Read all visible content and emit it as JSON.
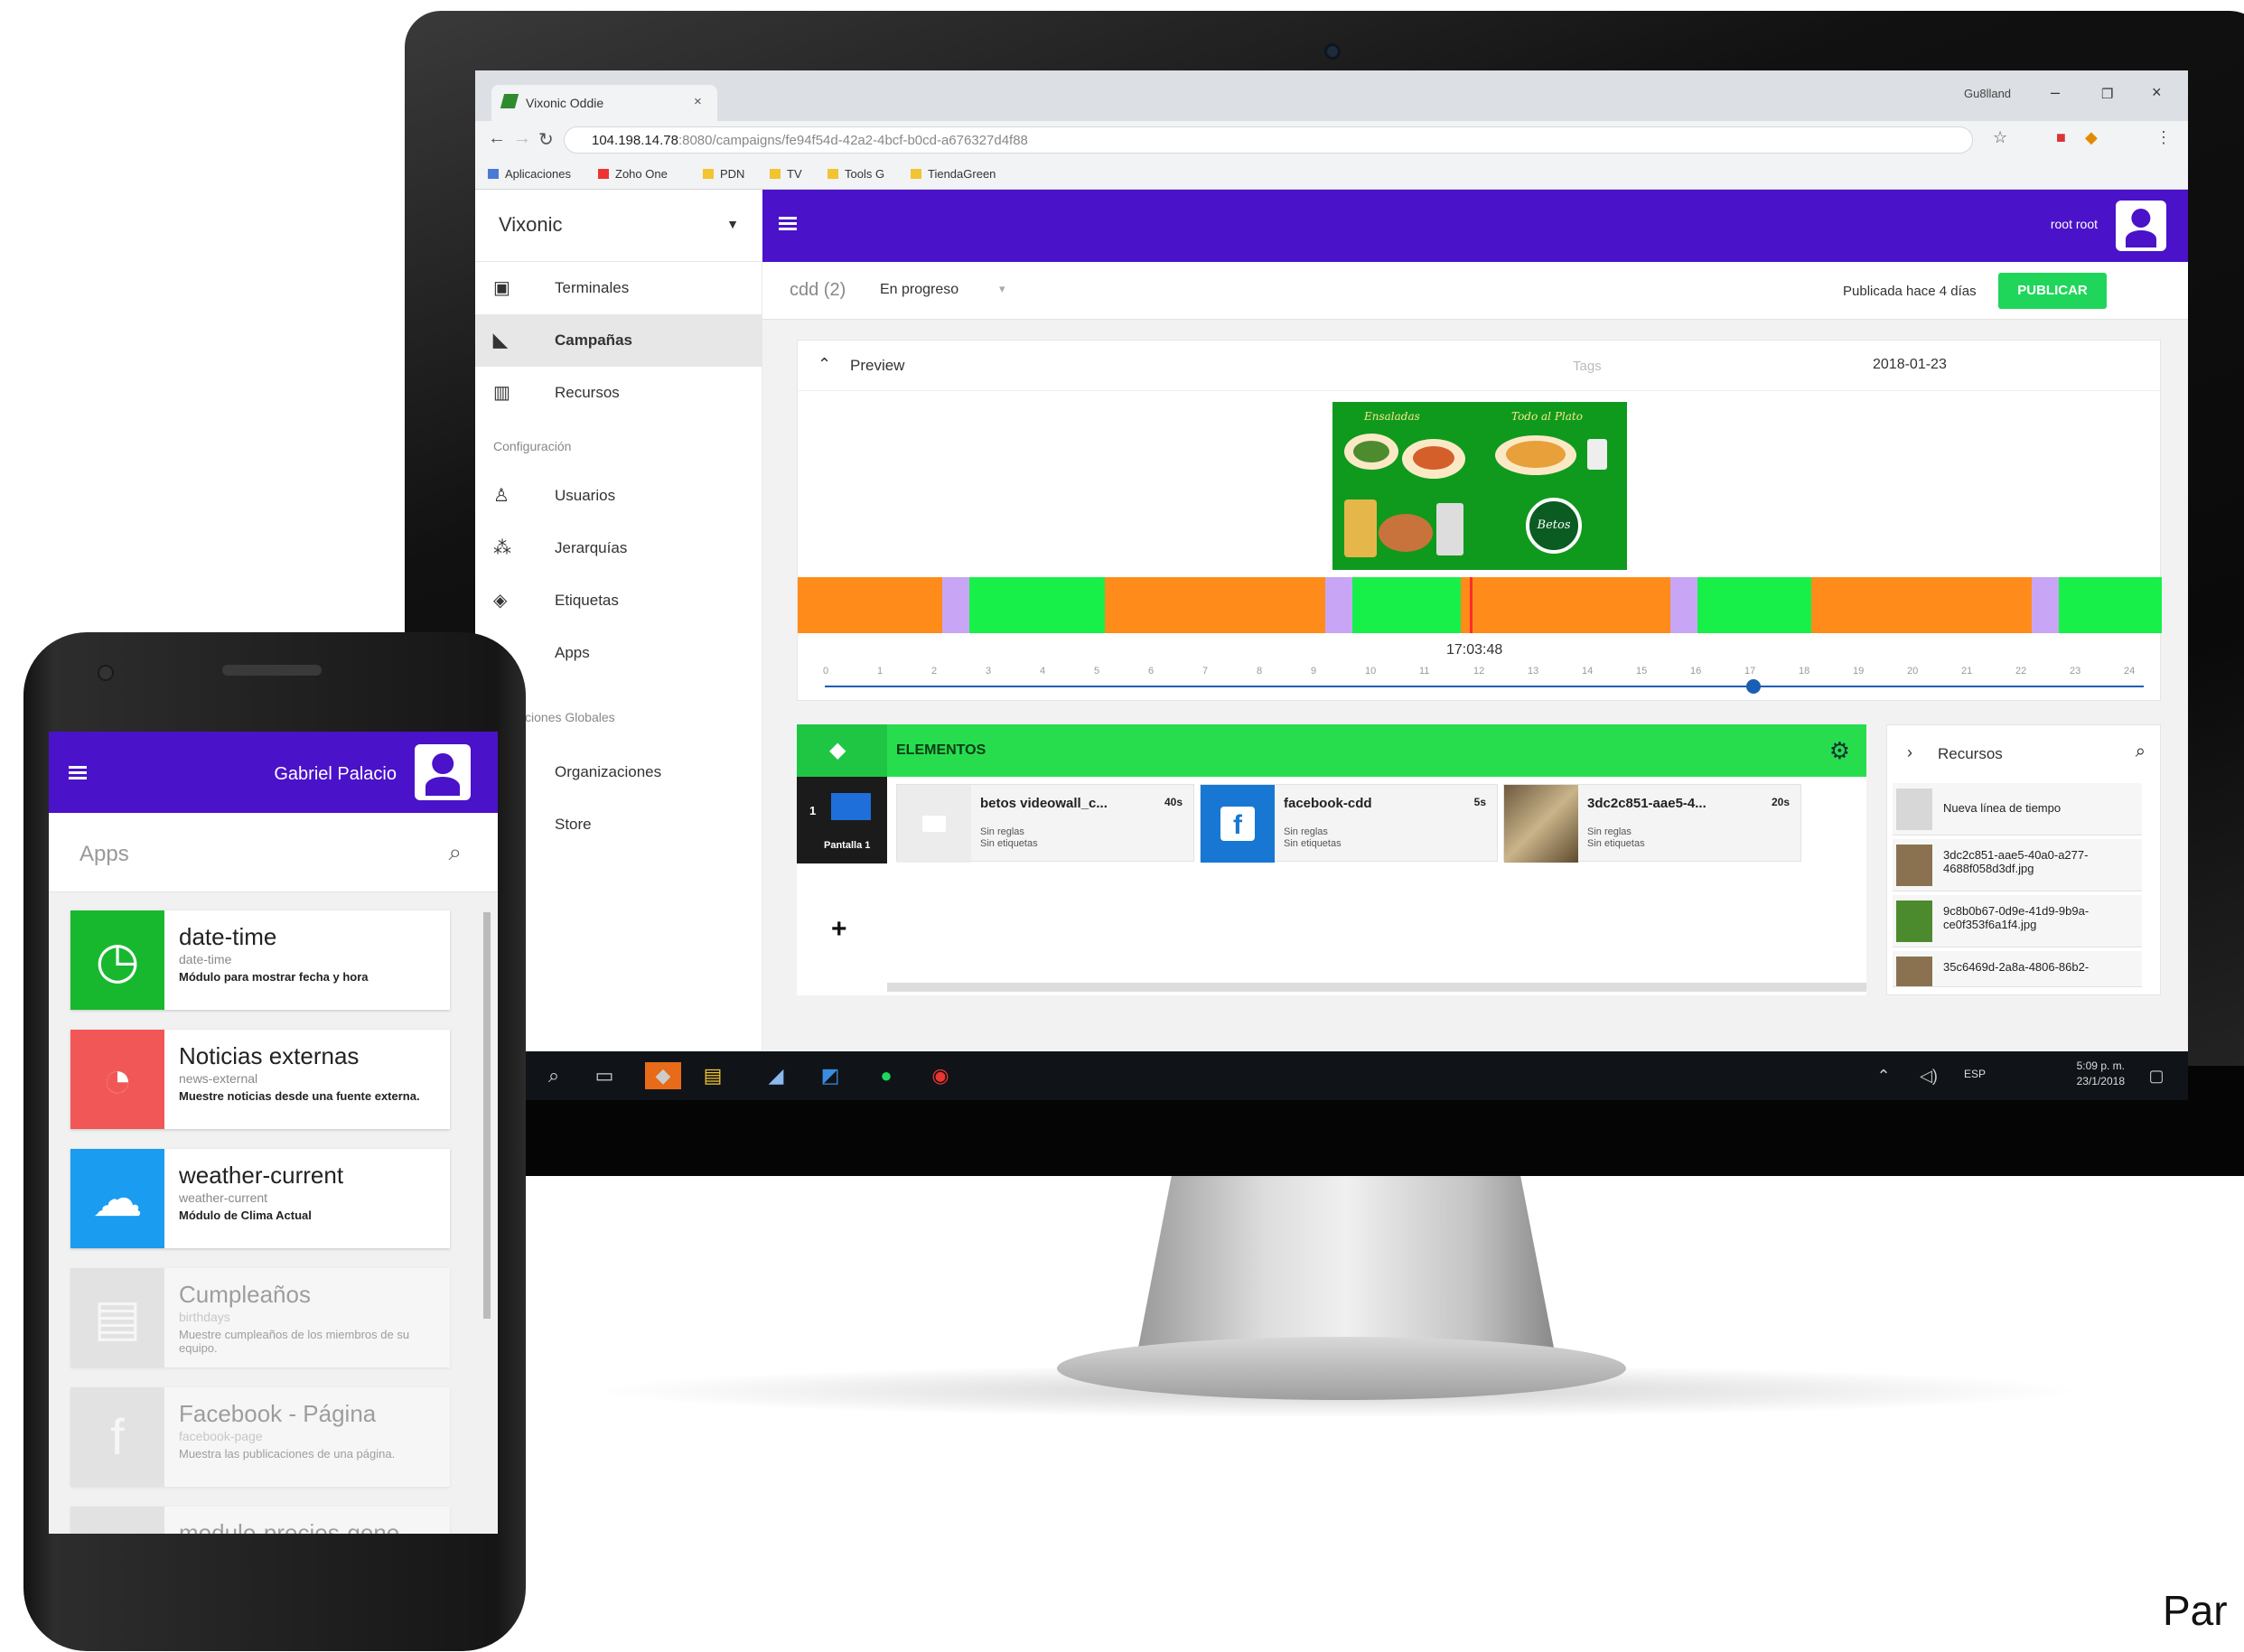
{
  "browser": {
    "tab_title": "Vixonic Oddie",
    "window_user": "Gu8lland",
    "url_host": "104.198.14.78",
    "url_rest": ":8080/campaigns/fe94f54d-42a2-4bcf-b0cd-a676327d4f88",
    "bookmarks": [
      "Aplicaciones",
      "Zoho One",
      "PDN",
      "TV",
      "Tools G",
      "TiendaGreen"
    ]
  },
  "app": {
    "brand": "Vixonic",
    "user": "root root",
    "colors": {
      "header": "#4a12c9",
      "accent_green": "#1fd65a",
      "timeline_orange": "#ff8c1a",
      "timeline_green": "#18f04a",
      "timeline_lilac": "#c8a6f5"
    },
    "sidebar": {
      "items": [
        {
          "label": "Terminales",
          "icon": "monitor-icon"
        },
        {
          "label": "Campañas",
          "icon": "megaphone-icon",
          "active": true
        },
        {
          "label": "Recursos",
          "icon": "barcode-icon"
        }
      ],
      "config_section": "Configuración",
      "config_items": [
        {
          "label": "Usuarios",
          "icon": "user-icon"
        },
        {
          "label": "Jerarquías",
          "icon": "hierarchy-icon"
        },
        {
          "label": "Etiquetas",
          "icon": "tag-icon"
        },
        {
          "label": "Apps",
          "icon": "apps-icon"
        }
      ],
      "global_section": "figuraciones Globales",
      "global_items": [
        {
          "label": "Organizaciones"
        },
        {
          "label": "Store"
        }
      ]
    },
    "campaign": {
      "name": "cdd (2)",
      "status": "En progreso",
      "published": "Publicada hace 4 días",
      "publish_label": "PUBLICAR"
    },
    "preview": {
      "title": "Preview",
      "tags_placeholder": "Tags",
      "date": "2018-01-23",
      "time": "17:03:48",
      "hours": [
        "0",
        "1",
        "2",
        "3",
        "4",
        "5",
        "6",
        "7",
        "8",
        "9",
        "10",
        "11",
        "12",
        "13",
        "14",
        "15",
        "16",
        "17",
        "18",
        "19",
        "20",
        "21",
        "22",
        "23",
        "24"
      ],
      "grid_captions": [
        "Ensaladas",
        "Todo al Plato"
      ],
      "badge_text": "Betos"
    },
    "elements": {
      "title": "ELEMENTOS",
      "screen_number": "1",
      "screen_label": "Pantalla 1",
      "items": [
        {
          "name": "betos videowall_c...",
          "duration": "40s",
          "rules": "Sin reglas",
          "tags": "Sin etiquetas"
        },
        {
          "name": "facebook-cdd",
          "duration": "5s",
          "rules": "Sin reglas",
          "tags": "Sin etiquetas"
        },
        {
          "name": "3dc2c851-aae5-4...",
          "duration": "20s",
          "rules": "Sin reglas",
          "tags": "Sin etiquetas"
        }
      ]
    },
    "resources": {
      "title": "Recursos",
      "items": [
        {
          "name": "Nueva línea de tiempo"
        },
        {
          "name": "3dc2c851-aae5-40a0-a277-4688f058d3df.jpg"
        },
        {
          "name": "9c8b0b67-0d9e-41d9-9b9a-ce0f353f6a1f4.jpg"
        },
        {
          "name": "35c6469d-2a8a-4806-86b2-"
        }
      ]
    },
    "taskbar": {
      "time": "5:09 p. m.",
      "date": "23/1/2018",
      "lang": "ESP"
    }
  },
  "phone": {
    "user": "Gabriel Palacio",
    "search_placeholder": "Apps",
    "apps": [
      {
        "name": "date-time",
        "id": "date-time",
        "desc": "Módulo para mostrar fecha y hora",
        "icon": "clock-icon",
        "color": "#18b82e"
      },
      {
        "name": "Noticias externas",
        "id": "news-external",
        "desc": "Muestre noticias desde una fuente externa.",
        "icon": "rss-icon",
        "color": "#f25757"
      },
      {
        "name": "weather-current",
        "id": "weather-current",
        "desc": "Módulo de Clima Actual",
        "icon": "weather-icon",
        "color": "#1a9cf0"
      },
      {
        "name": "Cumpleaños",
        "id": "birthdays",
        "desc": "Muestre cumpleaños de los miembros de su equipo.",
        "icon": "cake-icon",
        "color": "#cccccc"
      },
      {
        "name": "Facebook - Página",
        "id": "facebook-page",
        "desc": "Muestra las publicaciones de una página.",
        "icon": "facebook-icon",
        "color": "#cccccc"
      },
      {
        "name": "modulo-precios-gene...",
        "id": "",
        "desc": "",
        "icon": "generic-icon",
        "color": "#cccccc"
      }
    ]
  },
  "corner_text": "Par"
}
